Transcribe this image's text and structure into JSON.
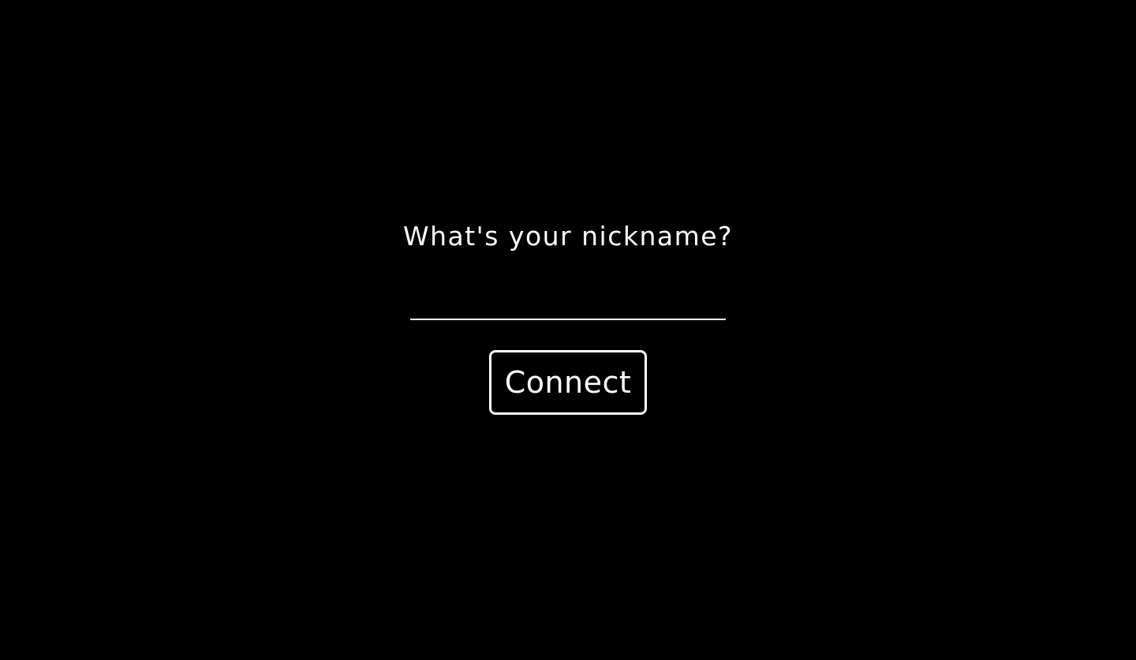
{
  "login": {
    "prompt": "What's your nickname?",
    "nickname_input": {
      "value": "",
      "placeholder": ""
    },
    "connect_label": "Connect"
  },
  "colors": {
    "background": "#000000",
    "foreground": "#ffffff"
  }
}
